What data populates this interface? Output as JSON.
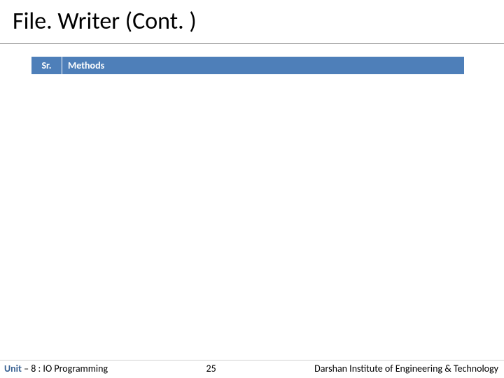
{
  "title": "File. Writer (Cont. )",
  "table": {
    "headers": {
      "sr": "Sr.",
      "methods": "Methods"
    }
  },
  "footer": {
    "unit_label": "Unit",
    "unit_rest": " – 8 : IO Programming",
    "page_number": "25",
    "institute": "Darshan Institute of Engineering & Technology"
  }
}
